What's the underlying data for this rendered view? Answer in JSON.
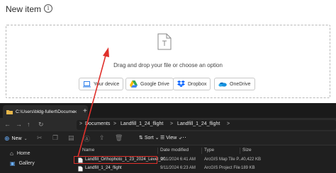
{
  "new_item": {
    "title": "New item",
    "info_icon": "i",
    "dropzone_text": "Drag and drop your file or choose an option",
    "sources": [
      {
        "label": "Your device",
        "icon": "laptop-icon"
      },
      {
        "label": "Google Drive",
        "icon": "google-drive-icon"
      },
      {
        "label": "Dropbox",
        "icon": "dropbox-icon"
      },
      {
        "label": "OneDrive",
        "icon": "onedrive-icon"
      }
    ]
  },
  "explorer": {
    "tab_label": "C:\\Users\\bldg-fullert\\Docume",
    "tab_close": "×",
    "tab_new": "+",
    "breadcrumb": [
      "Documents",
      "Landfill_1_24_flight",
      "Landfill_1_24_flight"
    ],
    "breadcrumb_sep": ">",
    "toolbar": {
      "new_label": "New",
      "sort_label": "Sort",
      "view_label": "View",
      "more": "···"
    },
    "sidebar": [
      {
        "label": "Home",
        "icon": "home-icon"
      },
      {
        "label": "Gallery",
        "icon": "gallery-icon"
      }
    ],
    "columns": [
      "Name",
      "Date modified",
      "Type",
      "Size"
    ],
    "files": [
      {
        "name": "Landfill_Orthophoto_1_23_2024_Level_20",
        "date": "9/11/2024 6:41 AM",
        "type": "ArcGIS Map Tile P...",
        "size": "40,422 KB"
      },
      {
        "name": "Landfill_1_24_flight",
        "date": "9/11/2024 6:23 AM",
        "type": "ArcGIS Project File",
        "size": "189 KB"
      }
    ]
  },
  "colors": {
    "highlight": "#e0302b",
    "explorer_bg": "#1f1f1f",
    "accent_blue": "#1a73e8"
  }
}
